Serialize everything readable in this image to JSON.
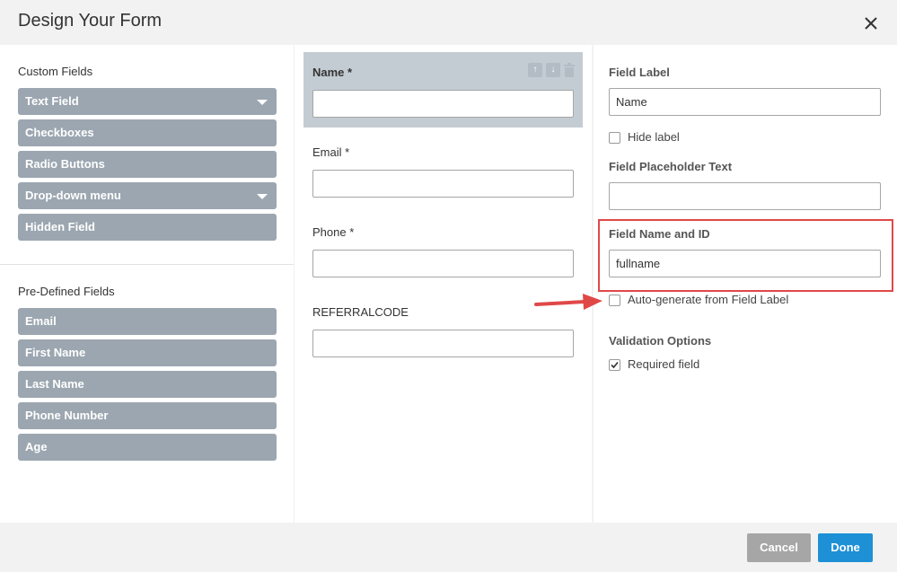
{
  "dialog": {
    "title": "Design Your Form"
  },
  "custom_fields": {
    "label": "Custom Fields",
    "items": [
      {
        "label": "Text Field",
        "has_dropdown": true
      },
      {
        "label": "Checkboxes",
        "has_dropdown": false
      },
      {
        "label": "Radio Buttons",
        "has_dropdown": false
      },
      {
        "label": "Drop-down menu",
        "has_dropdown": true
      },
      {
        "label": "Hidden Field",
        "has_dropdown": false
      }
    ]
  },
  "predefined_fields": {
    "label": "Pre-Defined Fields",
    "items": [
      "Email",
      "First Name",
      "Last Name",
      "Phone Number",
      "Age"
    ]
  },
  "form_fields": [
    {
      "label": "Name *",
      "selected": true
    },
    {
      "label": "Email *",
      "selected": false
    },
    {
      "label": "Phone *",
      "selected": false
    },
    {
      "label": "REFERRALCODE",
      "selected": false
    }
  ],
  "properties": {
    "field_label": {
      "label": "Field Label",
      "value": "Name"
    },
    "hide_label": {
      "label": "Hide label",
      "checked": false
    },
    "placeholder": {
      "label": "Field Placeholder Text",
      "value": ""
    },
    "field_name_id": {
      "label": "Field Name and ID",
      "value": "fullname"
    },
    "auto_generate": {
      "label": "Auto-generate from Field Label",
      "checked": false
    },
    "validation": {
      "label": "Validation Options"
    },
    "required": {
      "label": "Required field",
      "checked": true
    }
  },
  "footer": {
    "cancel_label": "Cancel",
    "done_label": "Done"
  },
  "colors": {
    "field_button": "#9ba6b0",
    "done_button": "#1e90d6",
    "cancel_button": "#a6a6a6",
    "highlight": "#e04848"
  }
}
